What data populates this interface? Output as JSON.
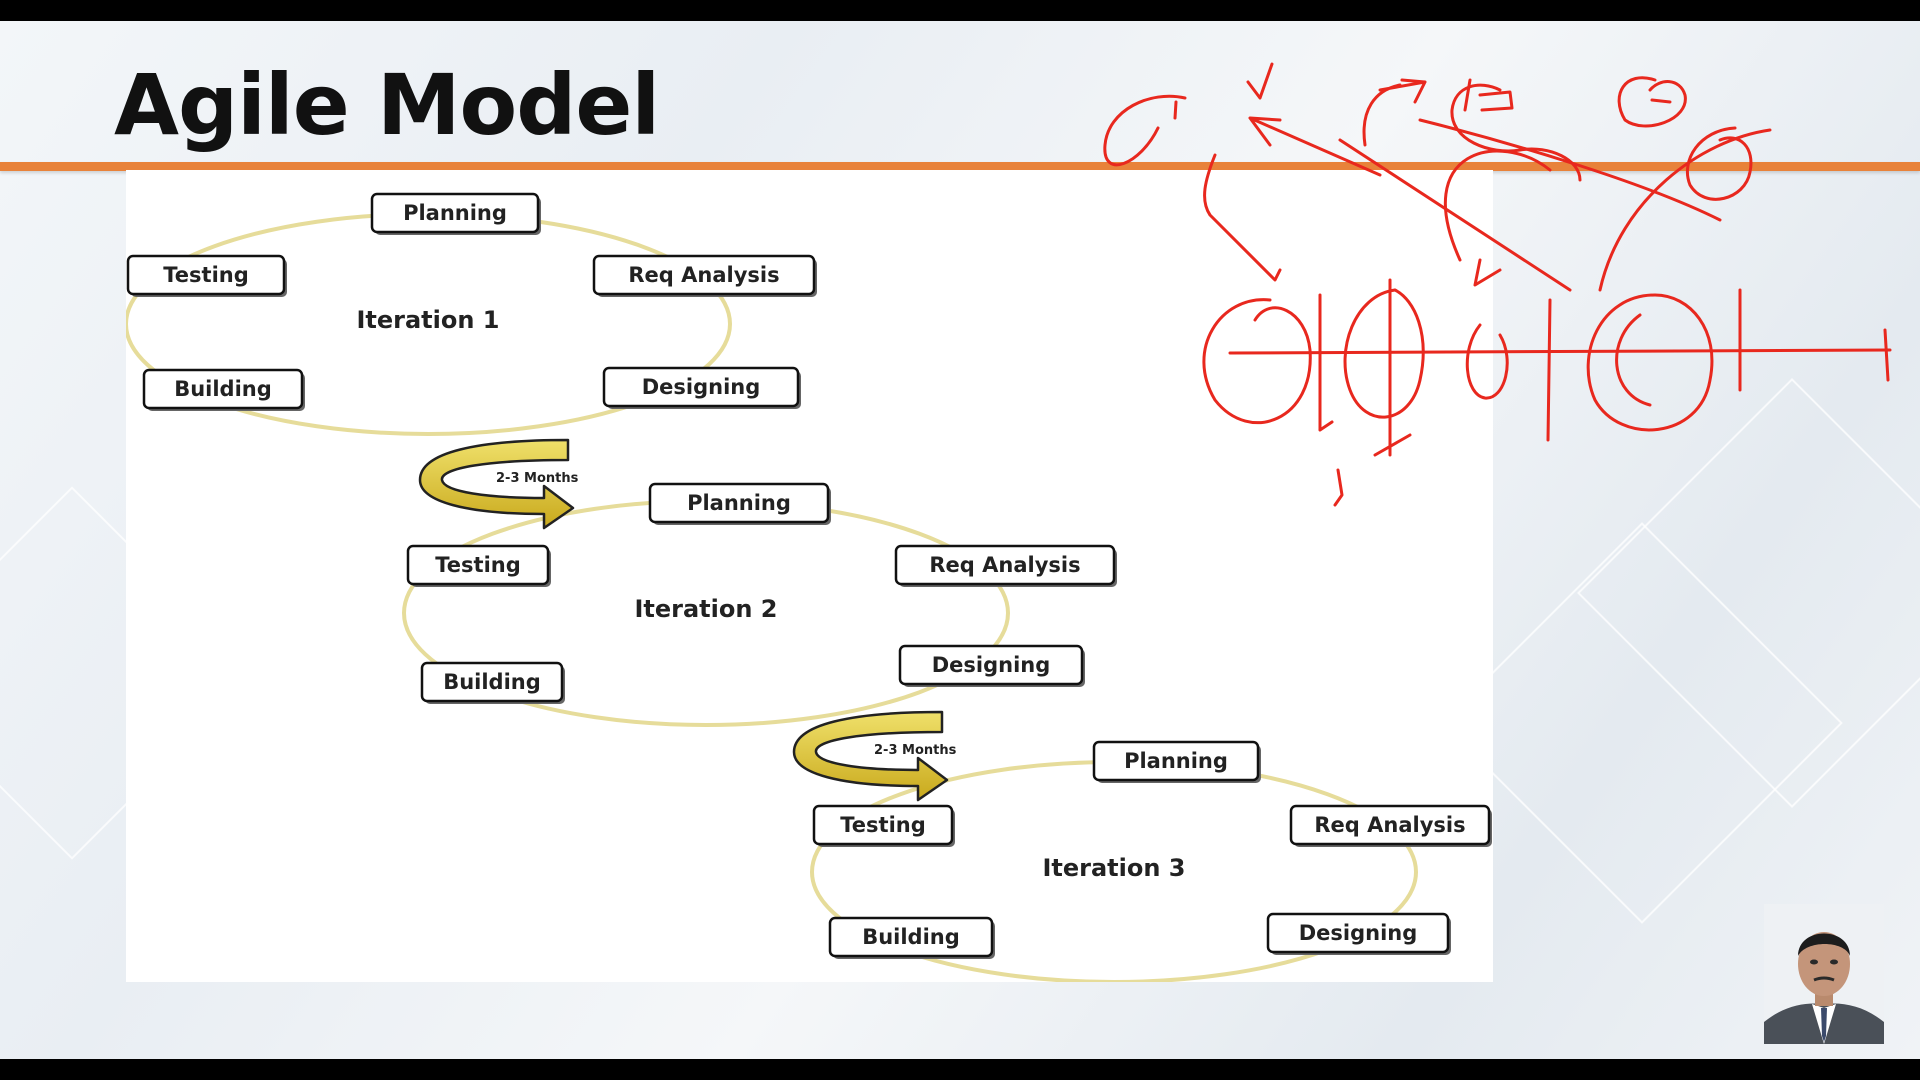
{
  "slide": {
    "title": "Agile Model"
  },
  "diagram": {
    "iterations": [
      {
        "label": "Iteration 1",
        "stages": [
          "Planning",
          "Req Analysis",
          "Designing",
          "Building",
          "Testing"
        ]
      },
      {
        "label": "Iteration 2",
        "stages": [
          "Planning",
          "Req Analysis",
          "Designing",
          "Building",
          "Testing"
        ]
      },
      {
        "label": "Iteration 3",
        "stages": [
          "Planning",
          "Req Analysis",
          "Designing",
          "Building",
          "Testing"
        ]
      }
    ],
    "transitions": [
      {
        "label": "2-3 Months"
      },
      {
        "label": "2-3 Months"
      }
    ]
  },
  "colors": {
    "accent_rule": "#e8823a",
    "cycle_line": "#e6dc9a",
    "arrow_fill": "#d9c12c",
    "annotation_ink": "#e8281e"
  },
  "icons": {
    "transition": "curved-arrow-icon",
    "presenter": "presenter-avatar-icon"
  }
}
